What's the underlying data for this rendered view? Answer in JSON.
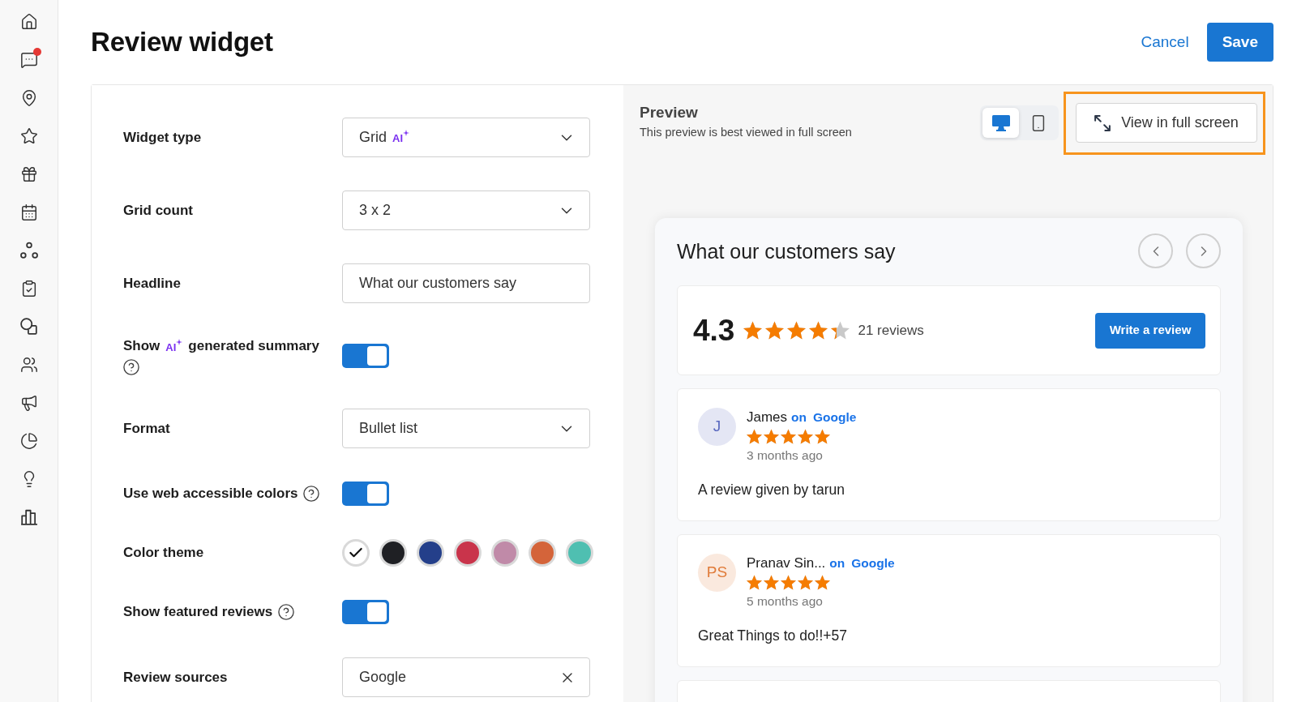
{
  "sidebar": {
    "items": [
      {
        "notification": false
      },
      {
        "notification": true
      },
      {
        "notification": false
      },
      {
        "notification": false
      },
      {
        "notification": false
      },
      {
        "notification": false
      },
      {
        "notification": false
      },
      {
        "notification": false
      },
      {
        "notification": false
      },
      {
        "notification": false
      },
      {
        "notification": false
      },
      {
        "notification": false
      },
      {
        "notification": false
      },
      {
        "notification": false
      }
    ]
  },
  "header": {
    "title": "Review widget",
    "cancel": "Cancel",
    "save": "Save"
  },
  "form": {
    "fields": [
      {
        "kind": "select",
        "label": "Widget type",
        "value": "Grid",
        "value_badge": "AI",
        "help": false
      },
      {
        "kind": "select",
        "label": "Grid count",
        "value": "3 x 2",
        "help": false
      },
      {
        "kind": "text",
        "label": "Headline",
        "value": "What our customers say",
        "help": false
      },
      {
        "kind": "toggle",
        "label": "Show",
        "label_badge": "AI",
        "label_end": "generated summary",
        "help": true,
        "on": true
      },
      {
        "kind": "select",
        "label": "Format",
        "value": "Bullet list",
        "help": false
      },
      {
        "kind": "toggle",
        "label": "Use web accessible colors",
        "help": true,
        "on": true
      },
      {
        "kind": "swatches",
        "label": "Color theme",
        "help": false,
        "options": [
          {
            "color": "#ffffff",
            "selected": true
          },
          {
            "color": "#1f2024",
            "selected": false
          },
          {
            "color": "#243f8a",
            "selected": false
          },
          {
            "color": "#c9344b",
            "selected": false
          },
          {
            "color": "#c08aa8",
            "selected": false
          },
          {
            "color": "#d4643a",
            "selected": false
          },
          {
            "color": "#4fbfb1",
            "selected": false
          }
        ]
      },
      {
        "kind": "toggle",
        "label": "Show featured reviews",
        "help": true,
        "on": true
      },
      {
        "kind": "combobox",
        "label": "Review sources",
        "value": "Google",
        "help": false
      }
    ]
  },
  "preview": {
    "title": "Preview",
    "subtitle": "This preview is best viewed in full screen",
    "devices": [
      {
        "kind": "desktop",
        "selected": true
      },
      {
        "kind": "mobile",
        "selected": false
      }
    ],
    "full_screen": {
      "label": "View in full screen",
      "highlighted": true
    },
    "widget": {
      "headline": "What our customers say",
      "summary": {
        "rating": "4.3",
        "stars": 4.3,
        "count": "21 reviews",
        "button": "Write a review"
      },
      "reviews": [
        {
          "initials": "J",
          "color": "#5c6bc0",
          "name": "James",
          "prefix": "on",
          "source": "Google",
          "stars": 5,
          "time": "3 months ago",
          "text": "A review given by tarun"
        },
        {
          "initials": "PS",
          "color": "#e07b39",
          "name": "Pranav Sin...",
          "prefix": "on",
          "source": "Google",
          "stars": 5,
          "time": "5 months ago",
          "text": "Great Things to do!!+57"
        }
      ]
    }
  }
}
